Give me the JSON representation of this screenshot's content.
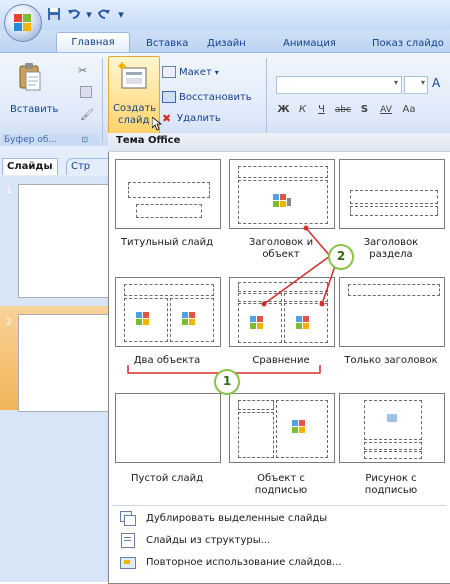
{
  "quick_access": {
    "save_icon": "save-icon",
    "undo_icon": "undo-icon",
    "redo_icon": "redo-icon",
    "more_icon": "customize-icon"
  },
  "tabs": [
    {
      "label": "Главная",
      "active": true
    },
    {
      "label": "Вставка"
    },
    {
      "label": "Дизайн"
    },
    {
      "label": "Анимация"
    },
    {
      "label": "Показ слайдо"
    }
  ],
  "ribbon": {
    "paste_label": "Вставить",
    "new_slide_line1": "Создать",
    "new_slide_line2": "слайд",
    "layout_label": "Макет",
    "layout_caret": "▾",
    "reset_label": "Восстановить",
    "delete_label": "Удалить",
    "clipboard_group": "Буфер об...",
    "font_caret": "▾",
    "grow_font": "A",
    "fmt_bold": "Ж",
    "fmt_italic": "К",
    "fmt_underline": "Ч",
    "fmt_strike": "abc",
    "fmt_shadow": "S",
    "fmt_spacing": "AV",
    "fmt_case": "Aa"
  },
  "left_pane": {
    "tab_slides": "Слайды",
    "tab_outline": "Стр",
    "slide1_num": "1",
    "slide2_num": "2"
  },
  "gallery": {
    "header": "Тема Office",
    "layouts": [
      {
        "line1": "Титульный слайд",
        "line2": ""
      },
      {
        "line1": "Заголовок и",
        "line2": "объект"
      },
      {
        "line1": "Заголовок",
        "line2": "раздела"
      },
      {
        "line1": "Два объекта",
        "line2": ""
      },
      {
        "line1": "Сравнение",
        "line2": ""
      },
      {
        "line1": "Только заголовок",
        "line2": ""
      },
      {
        "line1": "Пустой слайд",
        "line2": ""
      },
      {
        "line1": "Объект с",
        "line2": "подписью"
      },
      {
        "line1": "Рисунок с",
        "line2": "подписью"
      }
    ],
    "menu": [
      {
        "label": "Дублировать выделенные слайды",
        "icon": "duplicate-slides-icon"
      },
      {
        "label": "Слайды из структуры...",
        "icon": "slides-from-outline-icon"
      },
      {
        "label": "Повторное использование слайдов...",
        "icon": "reuse-slides-icon"
      }
    ]
  },
  "callouts": {
    "one": "1",
    "two": "2"
  },
  "colors": {
    "accent": "#15428b",
    "callout_green": "#8bc34a",
    "callout_arrow_red": "#d32f2f"
  }
}
